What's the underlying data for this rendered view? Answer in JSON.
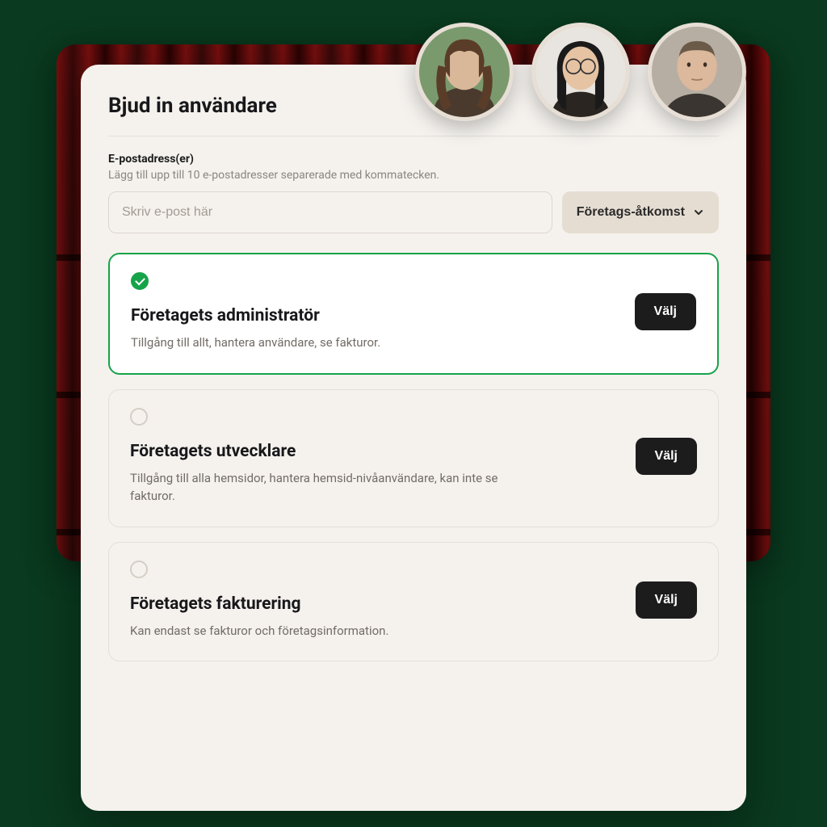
{
  "header": {
    "title": "Bjud in användare"
  },
  "email_field": {
    "label": "E-postadress(er)",
    "hint": "Lägg till upp till 10 e-postadresser separerade med kommatecken.",
    "placeholder": "Skriv e-post här"
  },
  "access_dropdown": {
    "selected": "Företags-åtkomst"
  },
  "roles": [
    {
      "id": "admin",
      "title": "Företagets administratör",
      "description": "Tillgång till allt, hantera användare, se fakturor.",
      "selected": true,
      "button": "Välj"
    },
    {
      "id": "developer",
      "title": "Företagets utvecklare",
      "description": "Tillgång till alla hemsidor, hantera hemsid-nivåanvändare, kan inte se fakturor.",
      "selected": false,
      "button": "Välj"
    },
    {
      "id": "billing",
      "title": "Företagets fakturering",
      "description": "Kan endast se fakturor och företagsinformation.",
      "selected": false,
      "button": "Välj"
    }
  ],
  "avatars": [
    {
      "name": "user-1",
      "bg": "#7a9a6e",
      "skin": "#d9b89a",
      "hair": "#5a3d28"
    },
    {
      "name": "user-2",
      "bg": "#e8e4df",
      "skin": "#e6c3a3",
      "hair": "#1a1a1a"
    },
    {
      "name": "user-3",
      "bg": "#b6aea3",
      "skin": "#dcb89c",
      "hair": "#6b5a48"
    }
  ]
}
